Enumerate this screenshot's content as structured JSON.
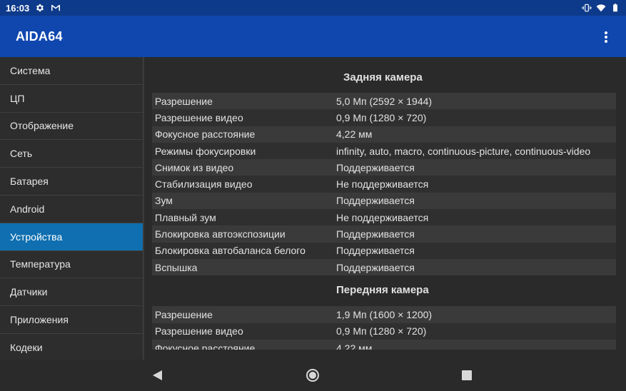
{
  "status_bar": {
    "time": "16:03"
  },
  "app_bar": {
    "title": "AIDA64"
  },
  "sidebar": {
    "items": [
      {
        "label": "Система"
      },
      {
        "label": "ЦП"
      },
      {
        "label": "Отображение"
      },
      {
        "label": "Сеть"
      },
      {
        "label": "Батарея"
      },
      {
        "label": "Android"
      },
      {
        "label": "Устройства"
      },
      {
        "label": "Температура"
      },
      {
        "label": "Датчики"
      },
      {
        "label": "Приложения"
      },
      {
        "label": "Кодеки"
      }
    ],
    "active_index": 6
  },
  "content": {
    "rear_camera": {
      "title": "Задняя камера",
      "rows": [
        {
          "key": "Разрешение",
          "value": "5,0 Мп (2592 × 1944)"
        },
        {
          "key": "Разрешение видео",
          "value": "0,9 Мп (1280 × 720)"
        },
        {
          "key": "Фокусное расстояние",
          "value": "4,22 мм"
        },
        {
          "key": "Режимы фокусировки",
          "value": "infinity, auto, macro, continuous-picture, continuous-video"
        },
        {
          "key": "Снимок из видео",
          "value": "Поддерживается"
        },
        {
          "key": "Стабилизация видео",
          "value": "Не поддерживается"
        },
        {
          "key": "Зум",
          "value": "Поддерживается"
        },
        {
          "key": "Плавный зум",
          "value": "Не поддерживается"
        },
        {
          "key": "Блокировка автоэкспозиции",
          "value": "Поддерживается"
        },
        {
          "key": "Блокировка автобаланса белого",
          "value": "Поддерживается"
        },
        {
          "key": "Вспышка",
          "value": "Поддерживается"
        }
      ]
    },
    "front_camera": {
      "title": "Передняя камера",
      "rows": [
        {
          "key": "Разрешение",
          "value": "1,9 Мп (1600 × 1200)"
        },
        {
          "key": "Разрешение видео",
          "value": "0,9 Мп (1280 × 720)"
        },
        {
          "key": "Фокусное расстояние",
          "value": "4,22 мм"
        }
      ]
    }
  }
}
